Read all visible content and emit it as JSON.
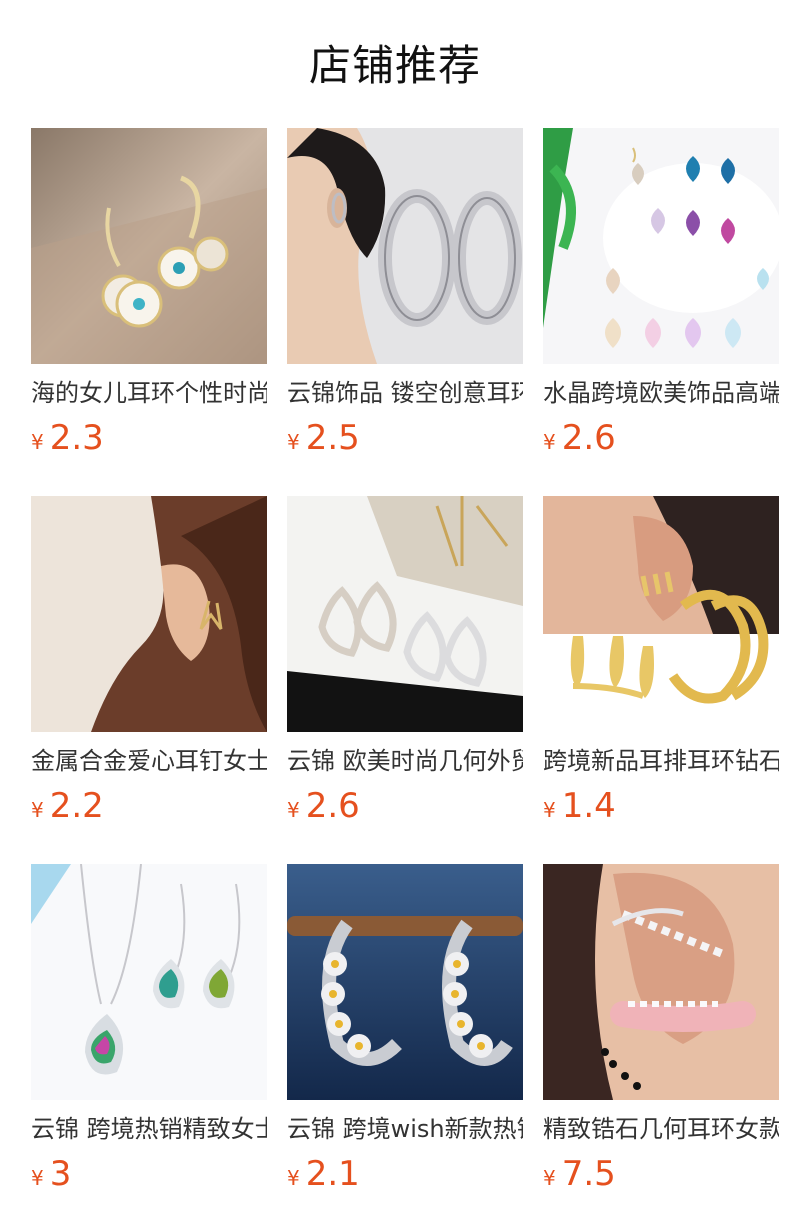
{
  "section": {
    "title": "店铺推荐"
  },
  "currency": "¥",
  "products": [
    {
      "name": "海的女儿耳环个性时尚",
      "price": "2.3",
      "image_icon": "gold-disc-earrings-image"
    },
    {
      "name": "云锦饰品 镂空创意耳环",
      "price": "2.5",
      "image_icon": "silver-hoop-earrings-image"
    },
    {
      "name": "水晶跨境欧美饰品高端",
      "price": "2.6",
      "image_icon": "crystal-drop-earrings-image"
    },
    {
      "name": "金属合金爱心耳钉女士",
      "price": "2.2",
      "image_icon": "heart-stud-earring-image"
    },
    {
      "name": "云锦 欧美时尚几何外贸",
      "price": "2.6",
      "image_icon": "teardrop-rhinestone-earrings-image"
    },
    {
      "name": "跨境新品耳排耳环钻石",
      "price": "1.4",
      "image_icon": "gold-claw-ear-cuff-image"
    },
    {
      "name": "云锦 跨境热销精致女士",
      "price": "3",
      "image_icon": "pendant-necklace-set-image"
    },
    {
      "name": "云锦 跨境wish新款热销",
      "price": "2.1",
      "image_icon": "daisy-hoop-earrings-image"
    },
    {
      "name": "精致锆石几何耳环女款",
      "price": "7.5",
      "image_icon": "zircon-ear-climber-image"
    }
  ]
}
